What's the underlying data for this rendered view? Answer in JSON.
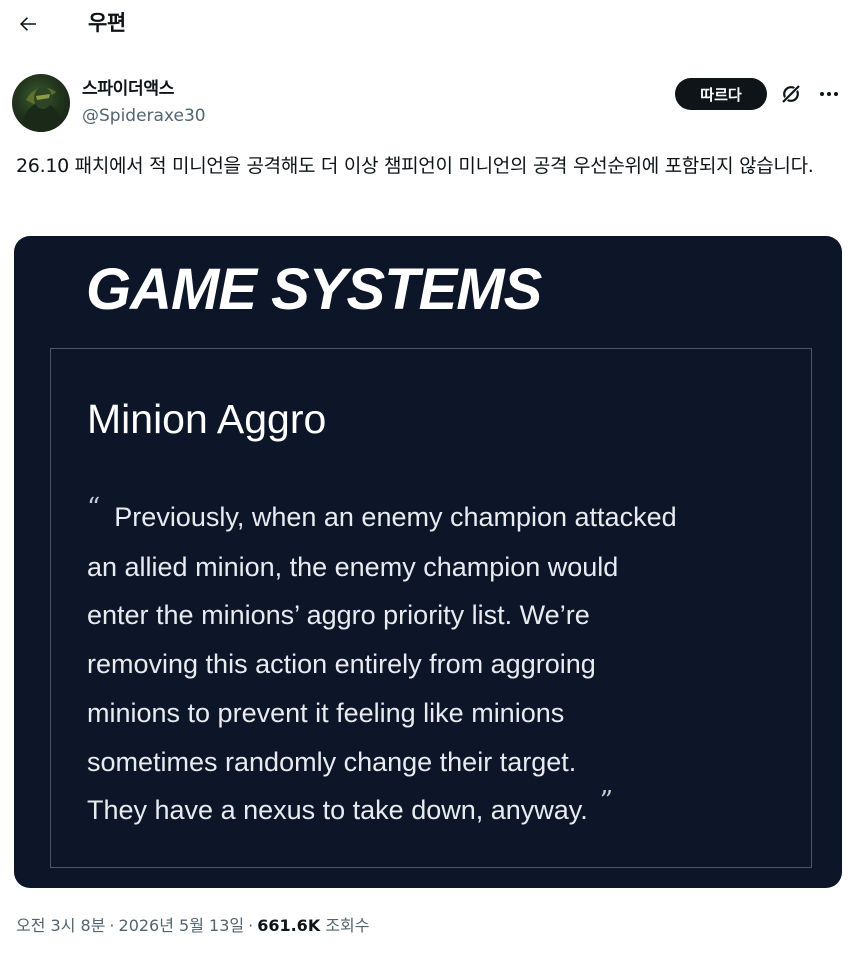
{
  "header": {
    "title": "우편"
  },
  "author": {
    "display_name": "스파이더액스",
    "handle": "@Spideraxe30"
  },
  "actions": {
    "follow_label": "따르다"
  },
  "tweet": {
    "text": "26.10 패치에서 적 미니언을 공격해도 더 이상 챔피언이 미니언의 공격 우선순위에 포함되지 않습니다."
  },
  "image": {
    "headline": "GAME SYSTEMS",
    "subtitle": "Minion Aggro",
    "open_quote": "“",
    "close_quote": "”",
    "quote_lines": [
      "Previously, when an enemy champion attacked",
      "an allied minion, the enemy champion would",
      "enter the minions’ aggro priority list. We’re",
      "removing this action entirely from aggroing",
      "minions to prevent it feeling like minions",
      "sometimes randomly change their target.",
      "They have a nexus to take down, anyway."
    ]
  },
  "meta": {
    "time": "오전 3시 8분",
    "separator": "·",
    "date": "2026년 5월 13일",
    "views_count": "661.6K",
    "views_label": "조회수"
  },
  "icons": {
    "back": "arrow-left-icon",
    "grok": "grok-icon",
    "more": "more-horizontal-icon"
  }
}
